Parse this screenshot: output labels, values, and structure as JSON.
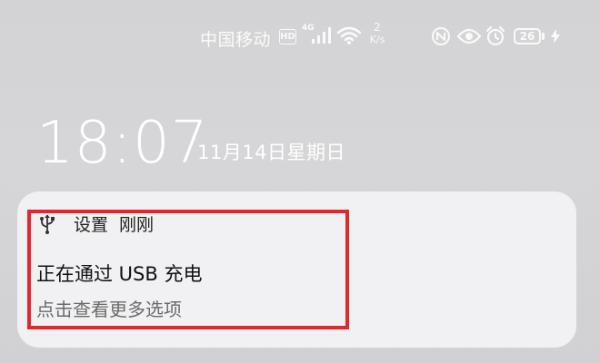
{
  "status_bar": {
    "carrier": "中国移动",
    "hd_label": "HD",
    "network_type": "4G",
    "net_speed_value": "2",
    "net_speed_unit": "K/s",
    "battery_level": "26",
    "icons": [
      "hd-icon",
      "signal-icon",
      "wifi-icon",
      "nfc-icon",
      "eye-comfort-icon",
      "alarm-icon",
      "battery-icon",
      "charging-bolt-icon"
    ]
  },
  "lockscreen": {
    "time": "18:07",
    "date": "11月14日星期日"
  },
  "notification": {
    "app_icon": "usb-icon",
    "app_name": "设置",
    "time_label": "刚刚",
    "title": "正在通过 USB 充电",
    "body": "点击查看更多选项"
  },
  "colors": {
    "background": "#d4d4d6",
    "card": "#f1f1f3",
    "highlight": "#e5262b"
  }
}
